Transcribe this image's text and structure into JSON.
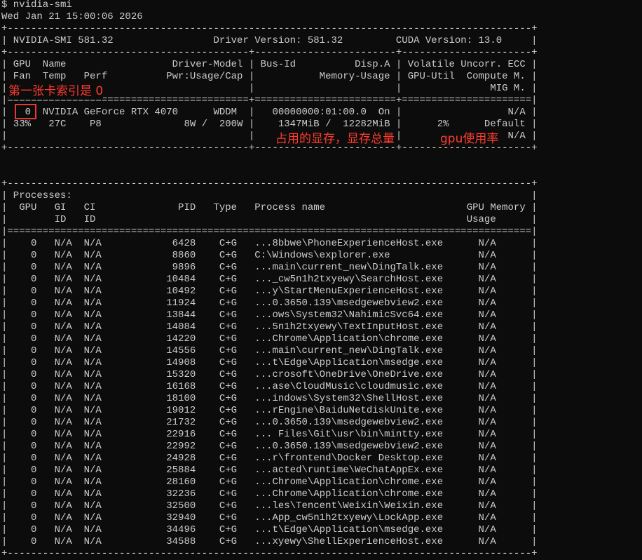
{
  "terminal": {
    "lines": [
      "$ nvidia-smi",
      "Wed Jan 21 15:00:06 2026",
      "+-----------------------------------------------------------------------------------------+",
      "| NVIDIA-SMI 581.32                 Driver Version: 581.32         CUDA Version: 13.0     |",
      "+-----------------------------------------+------------------------+----------------------+",
      "| GPU  Name                  Driver-Model | Bus-Id          Disp.A | Volatile Uncorr. ECC |",
      "| Fan  Temp   Perf          Pwr:Usage/Cap |           Memory-Usage | GPU-Util  Compute M. |",
      "|                                         |                        |               MIG M. |",
      "|=========================================+========================+======================|",
      "|   0  NVIDIA GeForce RTX 4070      WDDM  |   00000000:01:00.0  On |                  N/A |",
      "| 33%   27C    P8              8W /  200W |    1347MiB /  12282MiB |      2%      Default |",
      "|                                         |                        |                  N/A |",
      "+-----------------------------------------+------------------------+----------------------+",
      "",
      "",
      "+-----------------------------------------------------------------------------------------+",
      "| Processes:                                                                              |",
      "|  GPU   GI   CI              PID   Type   Process name                        GPU Memory |",
      "|        ID   ID                                                               Usage      |",
      "|=========================================================================================|",
      "|    0   N/A  N/A            6428    C+G   ...8bbwe\\PhoneExperienceHost.exe      N/A      |",
      "|    0   N/A  N/A            8860    C+G   C:\\Windows\\explorer.exe               N/A      |",
      "|    0   N/A  N/A            9896    C+G   ...main\\current_new\\DingTalk.exe      N/A      |",
      "|    0   N/A  N/A           10484    C+G   ..._cw5n1h2txyewy\\SearchHost.exe      N/A      |",
      "|    0   N/A  N/A           10492    C+G   ...y\\StartMenuExperienceHost.exe      N/A      |",
      "|    0   N/A  N/A           11924    C+G   ...0.3650.139\\msedgewebview2.exe      N/A      |",
      "|    0   N/A  N/A           13844    C+G   ...ows\\System32\\NahimicSvc64.exe      N/A      |",
      "|    0   N/A  N/A           14084    C+G   ...5n1h2txyewy\\TextInputHost.exe      N/A      |",
      "|    0   N/A  N/A           14220    C+G   ...Chrome\\Application\\chrome.exe      N/A      |",
      "|    0   N/A  N/A           14556    C+G   ...main\\current_new\\DingTalk.exe      N/A      |",
      "|    0   N/A  N/A           14908    C+G   ...t\\Edge\\Application\\msedge.exe      N/A      |",
      "|    0   N/A  N/A           15320    C+G   ...crosoft\\OneDrive\\OneDrive.exe      N/A      |",
      "|    0   N/A  N/A           16168    C+G   ...ase\\CloudMusic\\cloudmusic.exe      N/A      |",
      "|    0   N/A  N/A           18100    C+G   ...indows\\System32\\ShellHost.exe      N/A      |",
      "|    0   N/A  N/A           19012    C+G   ...rEngine\\BaiduNetdiskUnite.exe      N/A      |",
      "|    0   N/A  N/A           21732    C+G   ...0.3650.139\\msedgewebview2.exe      N/A      |",
      "|    0   N/A  N/A           22916    C+G   ... Files\\Git\\usr\\bin\\mintty.exe      N/A      |",
      "|    0   N/A  N/A           22992    C+G   ...0.3650.139\\msedgewebview2.exe      N/A      |",
      "|    0   N/A  N/A           24928    C+G   ...r\\frontend\\Docker Desktop.exe      N/A      |",
      "|    0   N/A  N/A           25884    C+G   ...acted\\runtime\\WeChatAppEx.exe      N/A      |",
      "|    0   N/A  N/A           28160    C+G   ...Chrome\\Application\\chrome.exe      N/A      |",
      "|    0   N/A  N/A           32236    C+G   ...Chrome\\Application\\chrome.exe      N/A      |",
      "|    0   N/A  N/A           32500    C+G   ...les\\Tencent\\Weixin\\Weixin.exe      N/A      |",
      "|    0   N/A  N/A           32940    C+G   ...App_cw5n1h2txyewy\\LockApp.exe      N/A      |",
      "|    0   N/A  N/A           34496    C+G   ...t\\Edge\\Application\\msedge.exe      N/A      |",
      "|    0   N/A  N/A           34588    C+G   ...xyewy\\ShellExperienceHost.exe      N/A      |",
      "+-----------------------------------------------------------------------------------------+"
    ]
  },
  "annotations": {
    "gpu_index": "第一张卡索引是 0",
    "memory": "占用的显存，显存总量",
    "gpu_util": "gpu使用率",
    "color": "#ff3b30"
  },
  "colors": {
    "background": "#0c0c0c",
    "foreground": "#cccccc",
    "highlight": "#e53935"
  }
}
